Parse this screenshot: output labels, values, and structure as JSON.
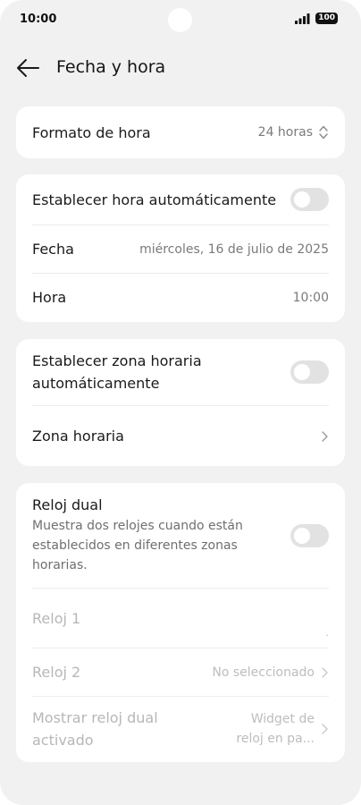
{
  "status_bar": {
    "time": "10:00",
    "battery": "100"
  },
  "header": {
    "title": "Fecha y hora"
  },
  "format_card": {
    "label": "Formato de hora",
    "value": "24 horas"
  },
  "auto_time_card": {
    "auto_label": "Establecer hora automáticamente",
    "date_label": "Fecha",
    "date_value": "miércoles, 16 de julio de 2025",
    "time_label": "Hora",
    "time_value": "10:00"
  },
  "timezone_card": {
    "auto_tz_line1": "Establecer zona horaria",
    "auto_tz_line2": "automáticamente",
    "tz_label": "Zona horaria"
  },
  "dual_clock_card": {
    "title": "Reloj dual",
    "desc_line1": "Muestra dos relojes cuando están",
    "desc_line2": "establecidos en diferentes zonas",
    "desc_line3": "horarias.",
    "clock1_label": "Reloj 1",
    "clock1_value": ".",
    "clock2_label": "Reloj 2",
    "clock2_value": "No seleccionado",
    "show_line1": "Mostrar reloj dual",
    "show_line2": "activado",
    "show_value_line1": "Widget de",
    "show_value_line2": "reloj en pa..."
  }
}
